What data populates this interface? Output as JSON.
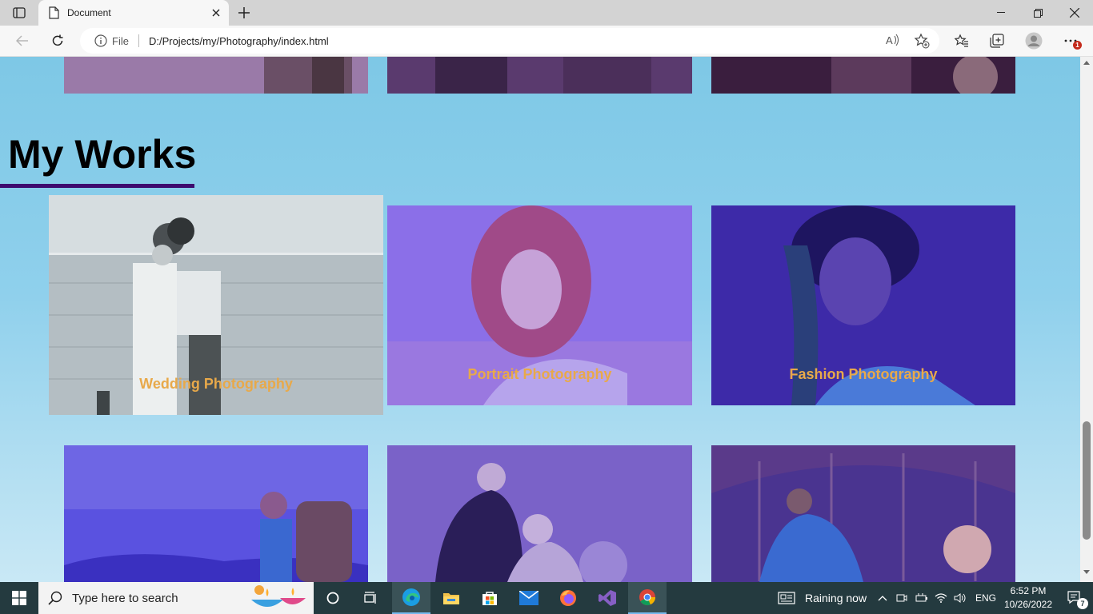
{
  "browser": {
    "tab_title": "Document",
    "address_prefix": "File",
    "url": "D:/Projects/my/Photography/index.html",
    "notification_count": "1"
  },
  "page": {
    "section_title": "My Works",
    "works": [
      {
        "label": "Wedding Photography"
      },
      {
        "label": "Portrait Photography"
      },
      {
        "label": "Fashion Photography"
      },
      {
        "label": ""
      },
      {
        "label": ""
      },
      {
        "label": ""
      }
    ]
  },
  "taskbar": {
    "search_placeholder": "Type here to search",
    "weather": "Raining now",
    "language": "ENG",
    "time": "6:52 PM",
    "date": "10/26/2022",
    "notifications": "7"
  },
  "colors": {
    "page_bg": "#7ec8e6",
    "title_underline": "#3d0a6e",
    "label_color": "#e8a94a",
    "card_overlay": "#5a3cff"
  }
}
